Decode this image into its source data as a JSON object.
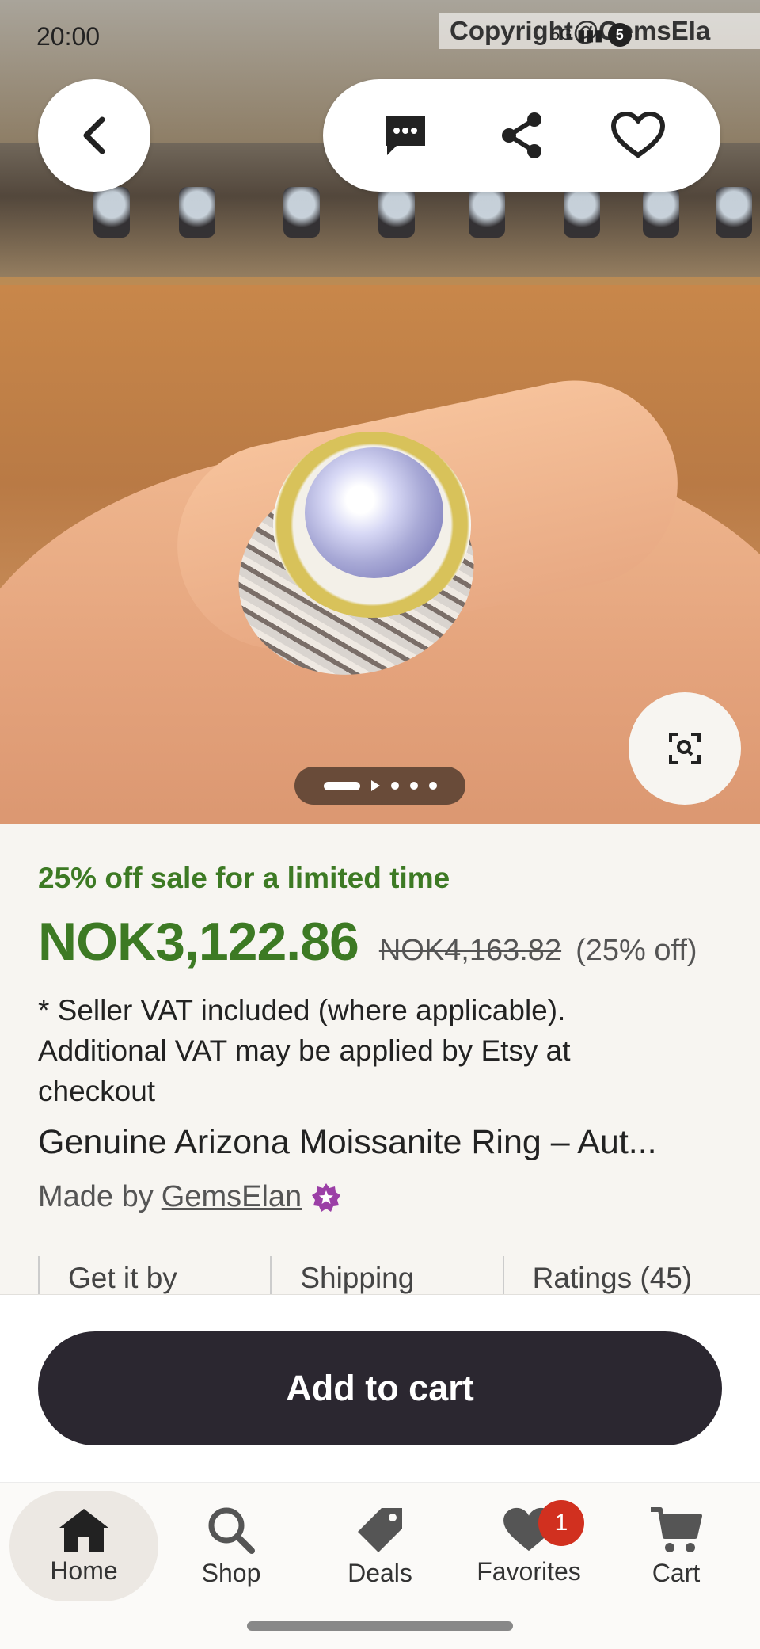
{
  "status_bar": {
    "time": "20:00",
    "watermark": "Copyright@GemsEla",
    "network": "5G",
    "battery": "5"
  },
  "hero": {
    "pager": {
      "current": 1,
      "total": 5,
      "has_video": true
    }
  },
  "icons": {
    "back": "chevron-left-icon",
    "message": "chat-bubble-icon",
    "share": "share-icon",
    "favorite": "heart-outline-icon",
    "zoom": "visual-search-icon"
  },
  "listing": {
    "sale_banner": "25% off sale for a limited time",
    "price": "NOK3,122.86",
    "original_price": "NOK4,163.82",
    "discount": "(25% off)",
    "vat_note": "* Seller VAT included (where applicable). Additional VAT may be applied by Etsy at checkout",
    "title": "Genuine Arizona Moissanite Ring – Aut...",
    "made_by_prefix": "Made by",
    "shop_name": "GemsElan",
    "info_columns": [
      "Get it by",
      "Shipping",
      "Ratings (45)"
    ]
  },
  "cart": {
    "button_label": "Add to cart"
  },
  "nav": {
    "items": [
      {
        "label": "Home",
        "active": true
      },
      {
        "label": "Shop"
      },
      {
        "label": "Deals"
      },
      {
        "label": "Favorites",
        "badge": "1"
      },
      {
        "label": "Cart"
      }
    ]
  },
  "colors": {
    "sale_green": "#3d7a24",
    "cart_button": "#2b2730",
    "badge_red": "#d1301f",
    "star_seller_purple": "#9b3fa6"
  }
}
